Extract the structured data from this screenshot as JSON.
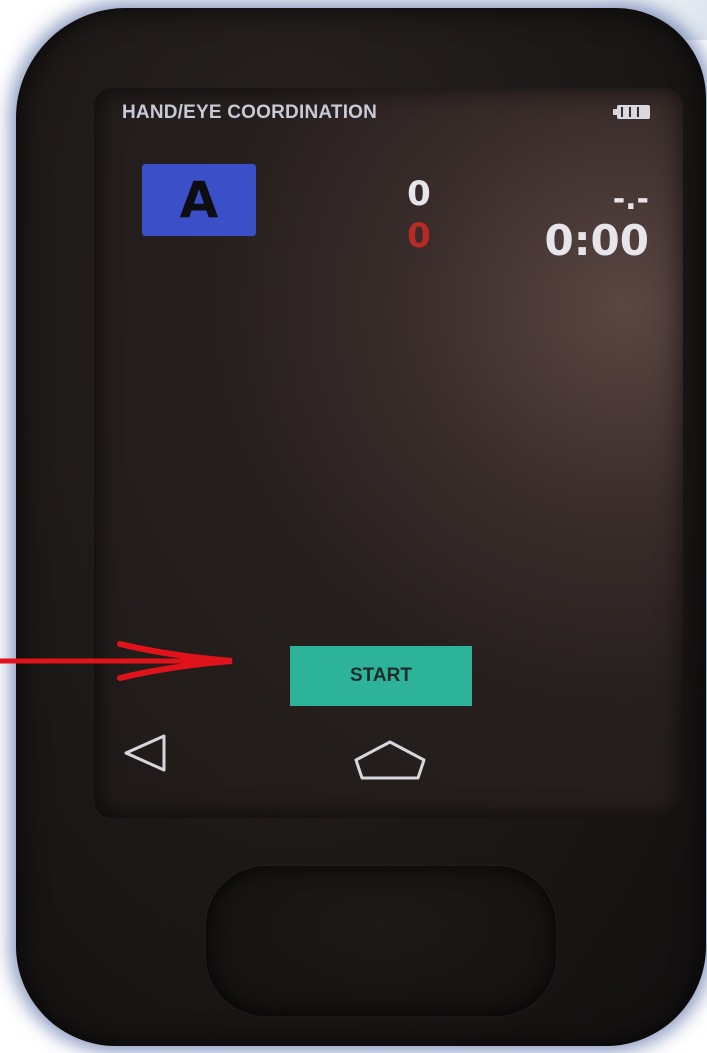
{
  "header": {
    "title": "HAND/EYE COORDINATION",
    "battery_icon": "battery-icon"
  },
  "game": {
    "mode_letter": "A",
    "hits": "0",
    "misses": "0",
    "rate": "-.-",
    "timer": "0:00"
  },
  "controls": {
    "start_label": "START"
  },
  "nav": {
    "back_icon": "back-triangle-icon",
    "home_icon": "home-icon"
  },
  "colors": {
    "mode_badge": "#3b4fc8",
    "start_button": "#2db39a",
    "miss_count": "#b92a24",
    "annotation_arrow": "#e0131b"
  }
}
